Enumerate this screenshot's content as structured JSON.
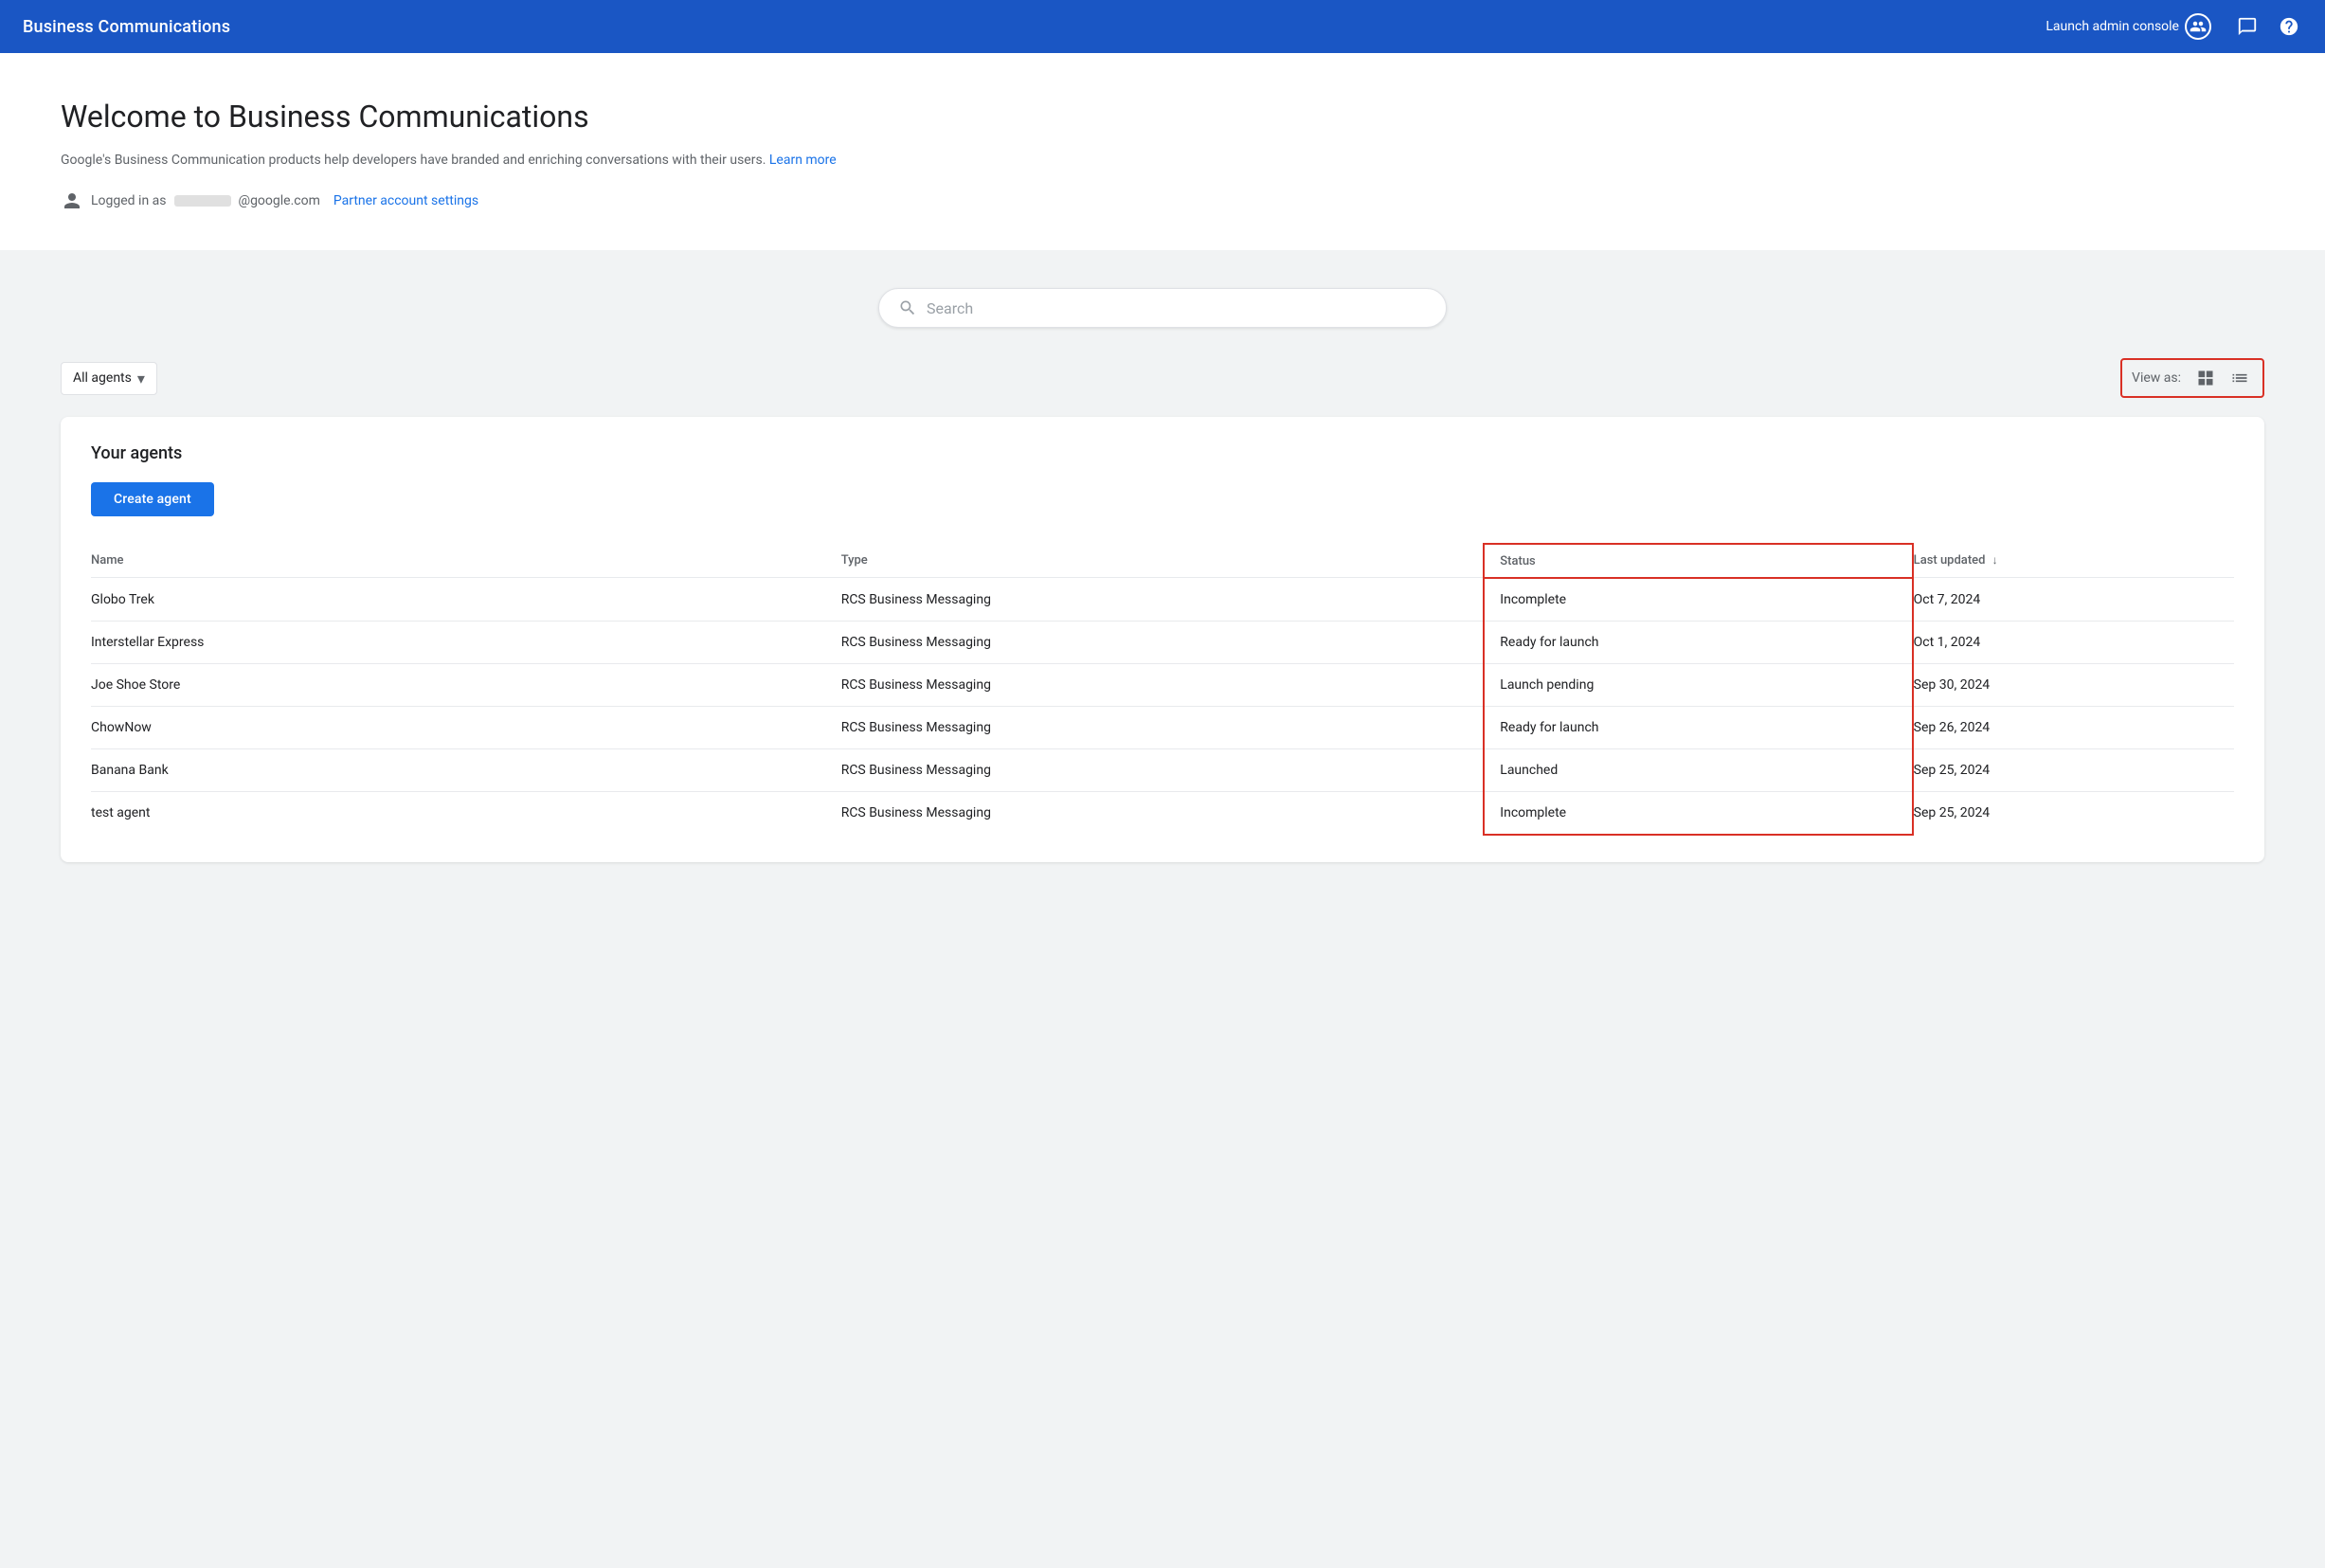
{
  "header": {
    "title": "Business Communications",
    "launch_admin_label": "Launch admin console",
    "icons": {
      "people": "👥",
      "chat": "💬",
      "help": "?"
    }
  },
  "welcome": {
    "title": "Welcome to Business Communications",
    "description": "Google's Business Communication products help developers have branded and enriching conversations with their users.",
    "learn_more_label": "Learn more",
    "logged_in_prefix": "Logged in as",
    "email_domain": "@google.com",
    "partner_link_label": "Partner account settings"
  },
  "search": {
    "placeholder": "Search"
  },
  "filter": {
    "label": "All agents",
    "view_as_label": "View as:"
  },
  "agents": {
    "section_title": "Your agents",
    "create_button_label": "Create agent",
    "table": {
      "columns": [
        {
          "key": "name",
          "label": "Name"
        },
        {
          "key": "type",
          "label": "Type"
        },
        {
          "key": "status",
          "label": "Status"
        },
        {
          "key": "last_updated",
          "label": "Last updated",
          "sort": "desc"
        }
      ],
      "rows": [
        {
          "name": "Globo Trek",
          "type": "RCS Business Messaging",
          "status": "Incomplete",
          "last_updated": "Oct 7, 2024"
        },
        {
          "name": "Interstellar Express",
          "type": "RCS Business Messaging",
          "status": "Ready for launch",
          "last_updated": "Oct 1, 2024"
        },
        {
          "name": "Joe Shoe Store",
          "type": "RCS Business Messaging",
          "status": "Launch pending",
          "last_updated": "Sep 30, 2024"
        },
        {
          "name": "ChowNow",
          "type": "RCS Business Messaging",
          "status": "Ready for launch",
          "last_updated": "Sep 26, 2024"
        },
        {
          "name": "Banana Bank",
          "type": "RCS Business Messaging",
          "status": "Launched",
          "last_updated": "Sep 25, 2024"
        },
        {
          "name": "test agent",
          "type": "RCS Business Messaging",
          "status": "Incomplete",
          "last_updated": "Sep 25, 2024"
        }
      ]
    }
  }
}
